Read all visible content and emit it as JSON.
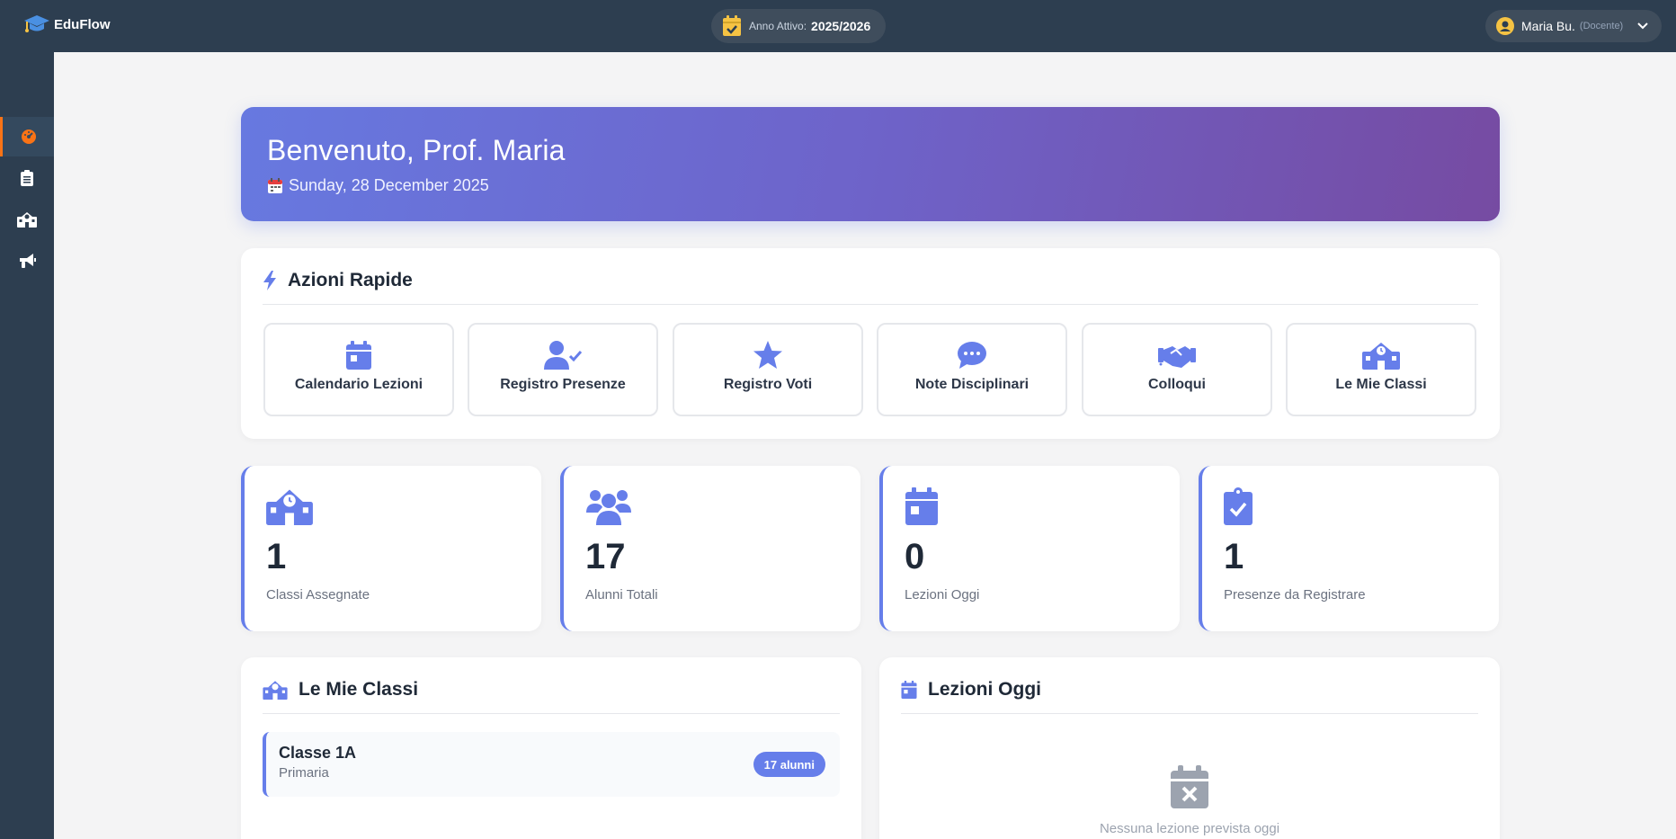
{
  "brand": {
    "name": "EduFlow",
    "icon": "graduation-cap-icon"
  },
  "header": {
    "year_label": "Anno Attivo:",
    "year_value": "2025/2026",
    "user_name": "Maria Bu.",
    "user_role": "(Docente)"
  },
  "sidebar": {
    "items": [
      {
        "icon": "dashboard-icon",
        "active": true
      },
      {
        "icon": "clipboard-icon",
        "active": false
      },
      {
        "icon": "school-icon",
        "active": false
      },
      {
        "icon": "megaphone-icon",
        "active": false
      }
    ]
  },
  "banner": {
    "title": "Benvenuto, Prof. Maria",
    "date": "Sunday, 28 December 2025"
  },
  "quick_actions": {
    "title": "Azioni Rapide",
    "items": [
      {
        "label": "Calendario Lezioni",
        "icon": "calendar-icon"
      },
      {
        "label": "Registro Presenze",
        "icon": "user-check-icon"
      },
      {
        "label": "Registro Voti",
        "icon": "star-icon"
      },
      {
        "label": "Note Disciplinari",
        "icon": "comment-icon"
      },
      {
        "label": "Colloqui",
        "icon": "handshake-icon"
      },
      {
        "label": "Le Mie Classi",
        "icon": "school-icon"
      }
    ]
  },
  "stats": [
    {
      "value": "1",
      "label": "Classi Assegnate",
      "icon": "school-icon"
    },
    {
      "value": "17",
      "label": "Alunni Totali",
      "icon": "users-icon"
    },
    {
      "value": "0",
      "label": "Lezioni Oggi",
      "icon": "calendar-icon"
    },
    {
      "value": "1",
      "label": "Presenze da Registrare",
      "icon": "clipboard-check-icon"
    }
  ],
  "my_classes": {
    "title": "Le Mie Classi",
    "items": [
      {
        "name": "Classe 1A",
        "level": "Primaria",
        "badge": "17 alunni"
      }
    ]
  },
  "lessons_today": {
    "title": "Lezioni Oggi",
    "empty_text": "Nessuna lezione prevista oggi"
  },
  "colors": {
    "accent": "#667eea",
    "topbar": "#2d3e50",
    "active": "#f97316"
  }
}
